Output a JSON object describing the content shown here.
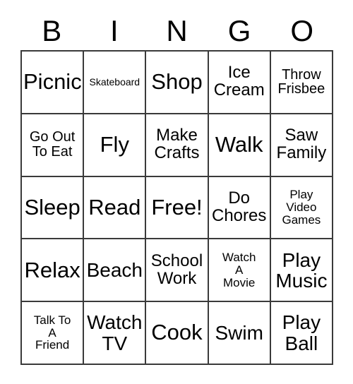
{
  "card": {
    "header_letters": [
      "B",
      "I",
      "N",
      "G",
      "O"
    ],
    "columns": 5,
    "rows": 5,
    "border_color": "#3a3a3a",
    "background_color": "#ffffff",
    "text_color": "#000000",
    "free_space_label": "Free!",
    "free_space_index": 12,
    "cells": [
      {
        "text": "Picnic",
        "lines": [
          "Picnic"
        ],
        "size": "fs-xl"
      },
      {
        "text": "Skateboard",
        "lines": [
          "Skateboard"
        ],
        "size": "fs-xxs"
      },
      {
        "text": "Shop",
        "lines": [
          "Shop"
        ],
        "size": "fs-xl"
      },
      {
        "text": "Ice Cream",
        "lines": [
          "Ice",
          "Cream"
        ],
        "size": "fs-md"
      },
      {
        "text": "Throw Frisbee",
        "lines": [
          "Throw",
          "Frisbee"
        ],
        "size": "fs-sm"
      },
      {
        "text": "Go Out To Eat",
        "lines": [
          "Go Out",
          "To Eat"
        ],
        "size": "fs-sm"
      },
      {
        "text": "Fly",
        "lines": [
          "Fly"
        ],
        "size": "fs-xl"
      },
      {
        "text": "Make Crafts",
        "lines": [
          "Make",
          "Crafts"
        ],
        "size": "fs-md"
      },
      {
        "text": "Walk",
        "lines": [
          "Walk"
        ],
        "size": "fs-xl"
      },
      {
        "text": "Saw Family",
        "lines": [
          "Saw",
          "Family"
        ],
        "size": "fs-md"
      },
      {
        "text": "Sleep",
        "lines": [
          "Sleep"
        ],
        "size": "fs-xl"
      },
      {
        "text": "Read",
        "lines": [
          "Read"
        ],
        "size": "fs-xl"
      },
      {
        "text": "Free!",
        "lines": [
          "Free!"
        ],
        "size": "fs-xl"
      },
      {
        "text": "Do Chores",
        "lines": [
          "Do",
          "Chores"
        ],
        "size": "fs-md"
      },
      {
        "text": "Play Video Games",
        "lines": [
          "Play",
          "Video",
          "Games"
        ],
        "size": "fs-xs"
      },
      {
        "text": "Relax",
        "lines": [
          "Relax"
        ],
        "size": "fs-xl"
      },
      {
        "text": "Beach",
        "lines": [
          "Beach"
        ],
        "size": "fs-lg"
      },
      {
        "text": "School Work",
        "lines": [
          "School",
          "Work"
        ],
        "size": "fs-md"
      },
      {
        "text": "Watch A Movie",
        "lines": [
          "Watch",
          "A",
          "Movie"
        ],
        "size": "fs-xs"
      },
      {
        "text": "Play Music",
        "lines": [
          "Play",
          "Music"
        ],
        "size": "fs-lg"
      },
      {
        "text": "Talk To A Friend",
        "lines": [
          "Talk To",
          "A",
          "Friend"
        ],
        "size": "fs-xs"
      },
      {
        "text": "Watch TV",
        "lines": [
          "Watch",
          "TV"
        ],
        "size": "fs-lg"
      },
      {
        "text": "Cook",
        "lines": [
          "Cook"
        ],
        "size": "fs-xl"
      },
      {
        "text": "Swim",
        "lines": [
          "Swim"
        ],
        "size": "fs-lg"
      },
      {
        "text": "Play Ball",
        "lines": [
          "Play",
          "Ball"
        ],
        "size": "fs-lg"
      }
    ]
  }
}
